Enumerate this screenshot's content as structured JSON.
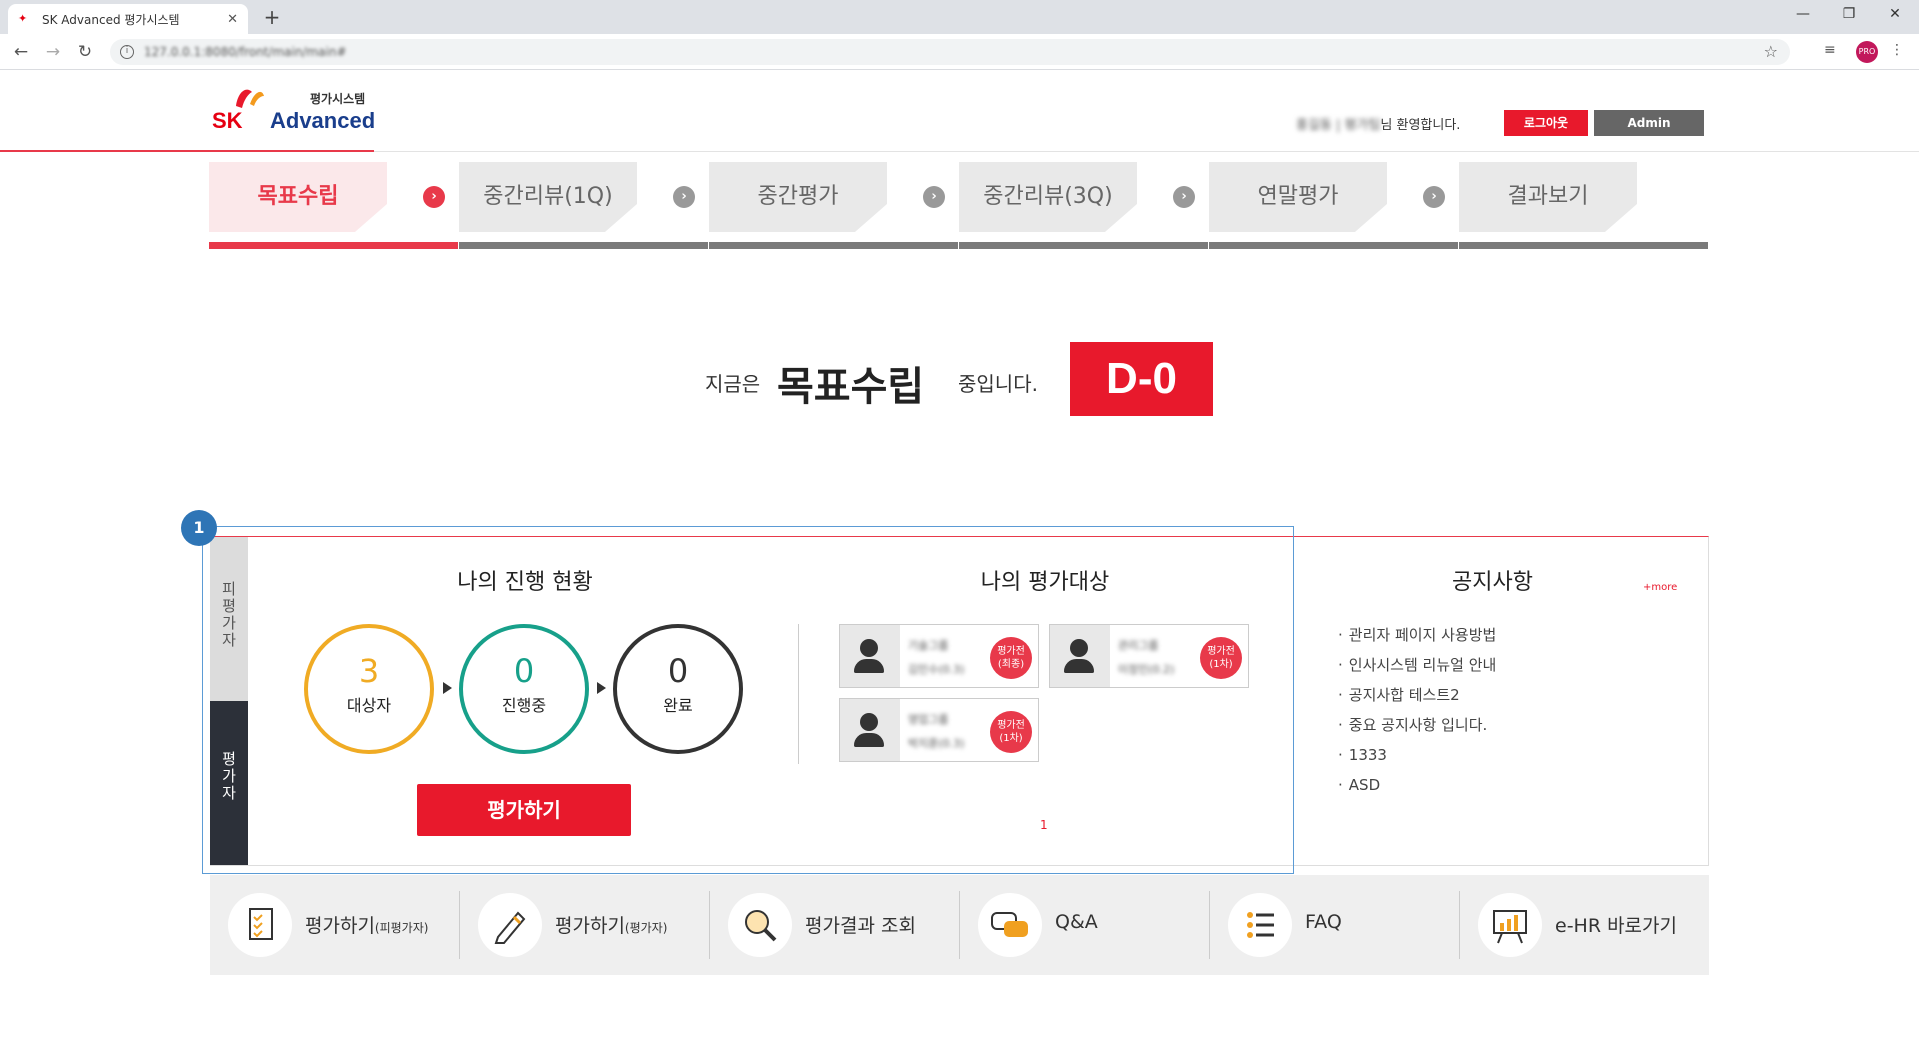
{
  "browser": {
    "tab_title": "SK Advanced 평가시스템",
    "url": "127.0.0.1:8080/front/main/main#",
    "profile_initials": "PRO"
  },
  "header": {
    "logo_sk": "SK",
    "logo_advanced": "Advanced",
    "logo_sub": "평가시스템",
    "user_name_blurred": "홍길동 | 평가팀",
    "welcome_suffix": "님 환영합니다.",
    "logout_label": "로그아웃",
    "admin_label": "Admin"
  },
  "steps": [
    {
      "label": "목표수립",
      "active": true
    },
    {
      "label": "중간리뷰(1Q)",
      "active": false
    },
    {
      "label": "중간평가",
      "active": false
    },
    {
      "label": "중간리뷰(3Q)",
      "active": false
    },
    {
      "label": "연말평가",
      "active": false
    },
    {
      "label": "결과보기",
      "active": false
    }
  ],
  "headline": {
    "prefix": "지금은",
    "phase": "목표수립",
    "suffix": "중입니다.",
    "dday": "D-0"
  },
  "panel": {
    "badge": "1",
    "tab_evaluatee": "피평가자",
    "tab_evaluator": "평가자",
    "progress_title": "나의 진행 현황",
    "progress": [
      {
        "value": "3",
        "label": "대상자"
      },
      {
        "value": "0",
        "label": "진행중"
      },
      {
        "value": "0",
        "label": "완료"
      }
    ],
    "eval_button": "평가하기",
    "targets_title": "나의 평가대상",
    "targets": [
      {
        "name": "기술그룹",
        "dept": "김민수(0.3)",
        "status": "평가전\n(최종)"
      },
      {
        "name": "관리그룹",
        "dept": "이정민(0.2)",
        "status": "평가전\n(1차)"
      },
      {
        "name": "영업그룹",
        "dept": "박지훈(0.3)",
        "status": "평가전\n(1차)"
      }
    ],
    "page": "1",
    "notice_title": "공지사항",
    "notice_more": "+more",
    "notices": [
      "관리자 페이지 사용방법",
      "인사시스템 리뉴얼 안내",
      "공지사합 테스트2",
      "중요 공지사항 입니다.",
      "1333",
      "ASD"
    ]
  },
  "quick_menu": [
    {
      "label": "평가하기",
      "sub": "(피평가자)",
      "icon": "checklist-icon"
    },
    {
      "label": "평가하기",
      "sub": "(평가자)",
      "icon": "pencil-icon"
    },
    {
      "label": "평가결과 조회",
      "sub": "",
      "icon": "magnifier-icon"
    },
    {
      "label": "Q&A",
      "sub": "",
      "icon": "chat-bubbles-icon"
    },
    {
      "label": "FAQ",
      "sub": "",
      "icon": "list-icon"
    },
    {
      "label": "e-HR 바로가기",
      "sub": "",
      "icon": "presentation-board-icon"
    }
  ],
  "colors": {
    "brand_red": "#e8192c",
    "accent_red": "#e8394a",
    "target_orange": "#f0ab24",
    "progress_teal": "#17a08a",
    "highlight_blue": "#2e75b6"
  }
}
